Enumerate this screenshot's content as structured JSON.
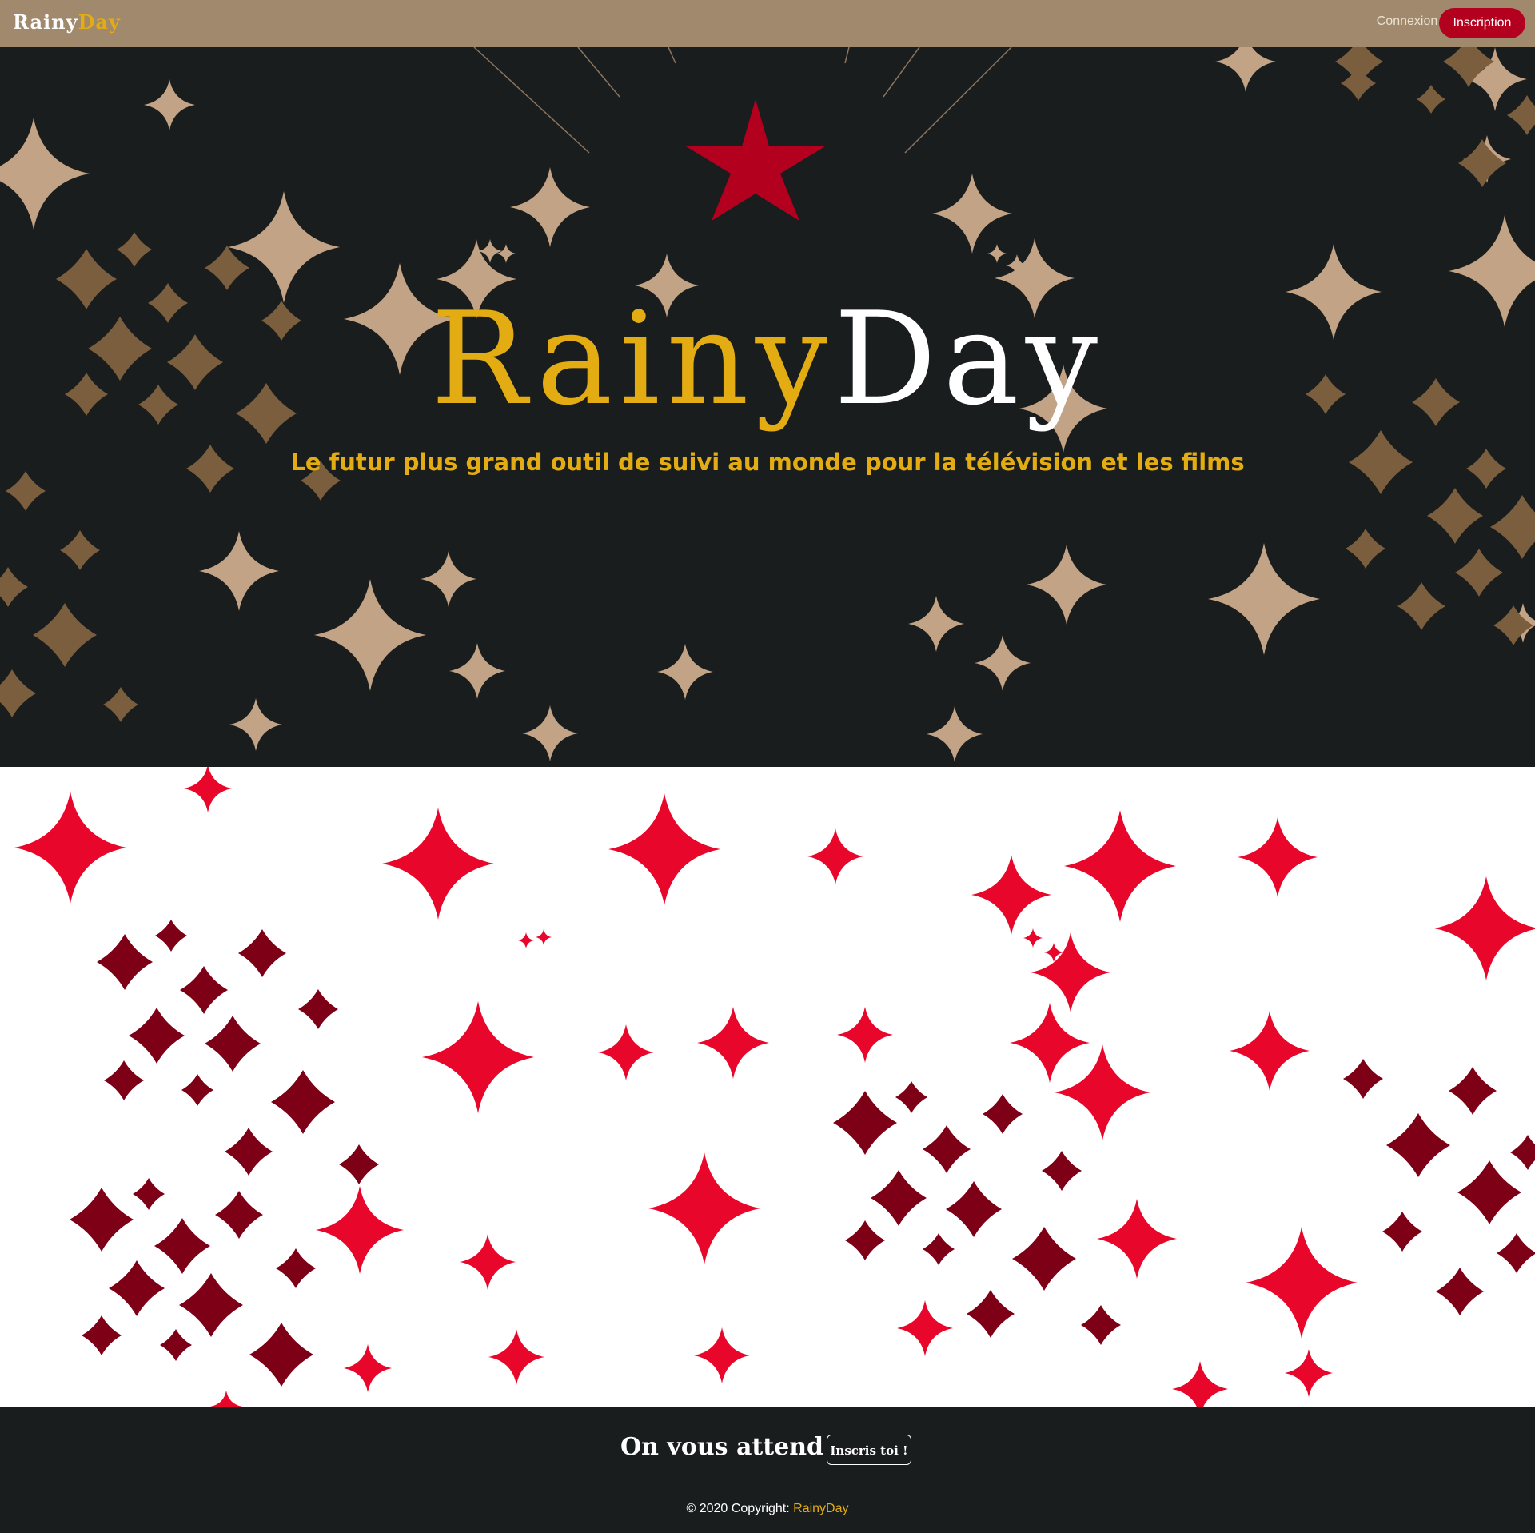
{
  "colors": {
    "navbar_bg": "#a0896c",
    "dark_bg": "#1a1d1e",
    "gold": "#e2ac12",
    "red": "#b3001e",
    "sparkle_light": "#c2a385",
    "sparkle_dark": "#7a5e3e",
    "sparkle_red": "#e8062b",
    "sparkle_darkred": "#7d0016"
  },
  "navbar": {
    "brand_part1": "Rainy",
    "brand_part2": "Day",
    "login_label": "Connexion",
    "signup_label": "Inscription"
  },
  "hero": {
    "logo_part1": "Rainy",
    "logo_part2": "Day",
    "tagline": "Le futur plus grand outil de suivi au monde pour la télévision et les films",
    "decoration_icon": "red-star-icon"
  },
  "footer": {
    "cta_text": "On vous attend",
    "cta_button": "Inscris toi !",
    "copyright_prefix": "© 2020 Copyright: ",
    "copyright_brand": "RainyDay"
  }
}
